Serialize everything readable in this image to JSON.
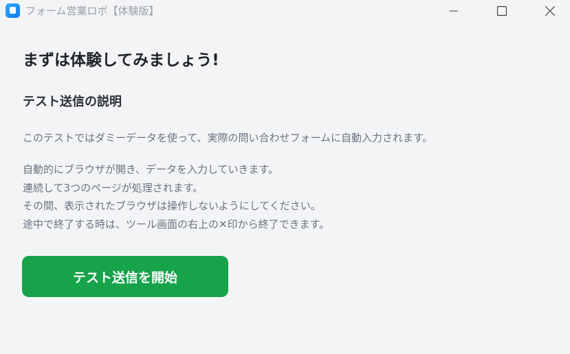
{
  "window": {
    "title": "フォーム営業ロボ【体験版】",
    "controls": {
      "minimize_icon": "minimize-icon",
      "maximize_icon": "maximize-icon",
      "close_icon": "close-icon"
    }
  },
  "main": {
    "heading": "まずは体験してみましょう!",
    "section_title": "テスト送信の説明",
    "description": "このテストではダミーデータを使って、実際の問い合わせフォームに自動入力されます。",
    "details": [
      "自動的にブラウザが開き、データを入力していきます。",
      "連続して3つのページが処理されます。",
      "その間、表示されたブラウザは操作しないようにしてください。",
      "途中で終了する時は、ツール画面の右上の✕印から終了できます。"
    ],
    "start_button_label": "テスト送信を開始"
  },
  "colors": {
    "background": "#f3f4f6",
    "accent_button": "#16a34a",
    "heading_text": "#1f2328",
    "body_text": "#6b7280",
    "app_icon": "#0a7bf0"
  }
}
